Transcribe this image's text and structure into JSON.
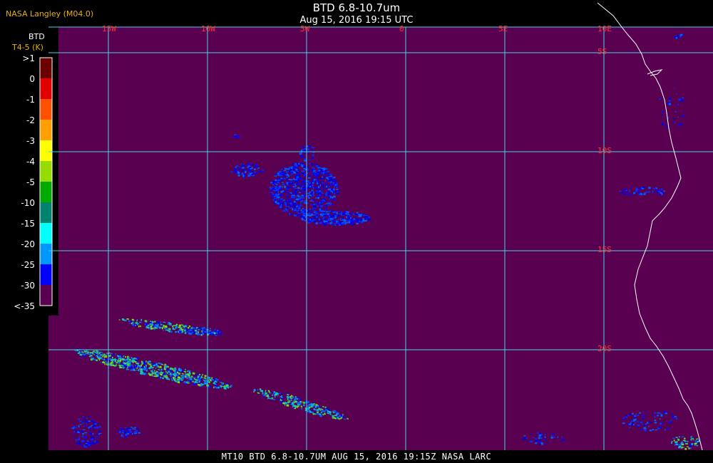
{
  "provider": "NASA Langley (M04.0)",
  "title": "BTD 6.8-10.7um",
  "subtitle": "Aug 15, 2016 19:15 UTC",
  "footer": "MT10  BTD 6.8-10.7UM   AUG 15, 2016 19:15Z   NASA LARC",
  "legend": {
    "title": "BTD",
    "subtitle": "T4-5 (K)",
    "labels": [
      ">1",
      "0",
      "-1",
      "-2",
      "-3",
      "-4",
      "-5",
      "-10",
      "-15",
      "-20",
      "-25",
      "-30",
      "<-35"
    ],
    "colors": [
      "#6b0000",
      "#e10000",
      "#ff5000",
      "#ffa000",
      "#ffff00",
      "#96dc00",
      "#00aa00",
      "#00826e",
      "#00ffff",
      "#0096ff",
      "#0000ff",
      "#5a0050"
    ]
  },
  "map": {
    "background": "#5a0050",
    "grid_color": "#40d8e8",
    "coast_color": "#ffffff",
    "label_color": "#ff3030",
    "lon_labels": [
      "15W",
      "10W",
      "5W",
      "0",
      "5E",
      "10E"
    ],
    "lat_labels": [
      "5S",
      "10S",
      "15S",
      "20S"
    ]
  },
  "colors": {
    "provider_text": "#e8b000",
    "legend_sub_text": "#e8b000"
  }
}
